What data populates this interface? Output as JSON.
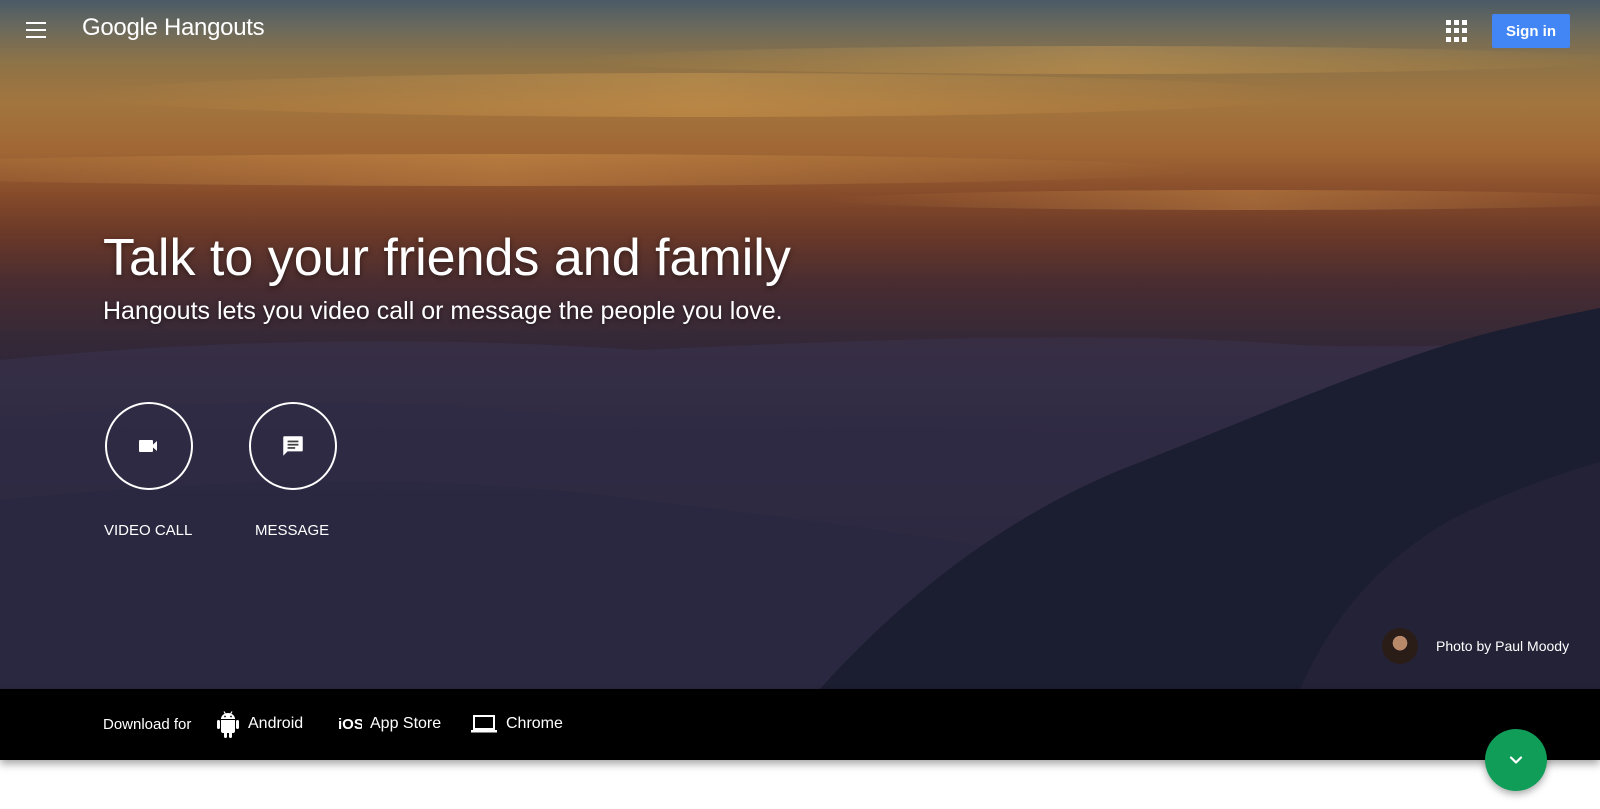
{
  "header": {
    "logo_google": "Google",
    "logo_product": "Hangouts",
    "menu_icon": "menu-icon",
    "apps_icon": "apps-grid-icon",
    "sign_in_label": "Sign in"
  },
  "hero": {
    "headline": "Talk to your friends and family",
    "subheadline": "Hangouts lets you video call or message the people you love.",
    "actions": [
      {
        "label": "VIDEO CALL",
        "icon": "video-camera-icon"
      },
      {
        "label": "MESSAGE",
        "icon": "message-icon"
      }
    ],
    "credit": {
      "text": "Photo by Paul Moody"
    }
  },
  "download_bar": {
    "label": "Download for",
    "links": [
      {
        "label": "Android",
        "icon": "android-icon"
      },
      {
        "label": "App Store",
        "icon": "ios-icon"
      },
      {
        "label": "Chrome",
        "icon": "laptop-icon"
      }
    ]
  },
  "scroll_button": {
    "icon": "chevron-down-icon"
  },
  "colors": {
    "sign_in_bg": "#4285f4",
    "fab_bg": "#0f9d58",
    "download_bar_bg": "#000000",
    "text_on_hero": "#ffffff"
  }
}
